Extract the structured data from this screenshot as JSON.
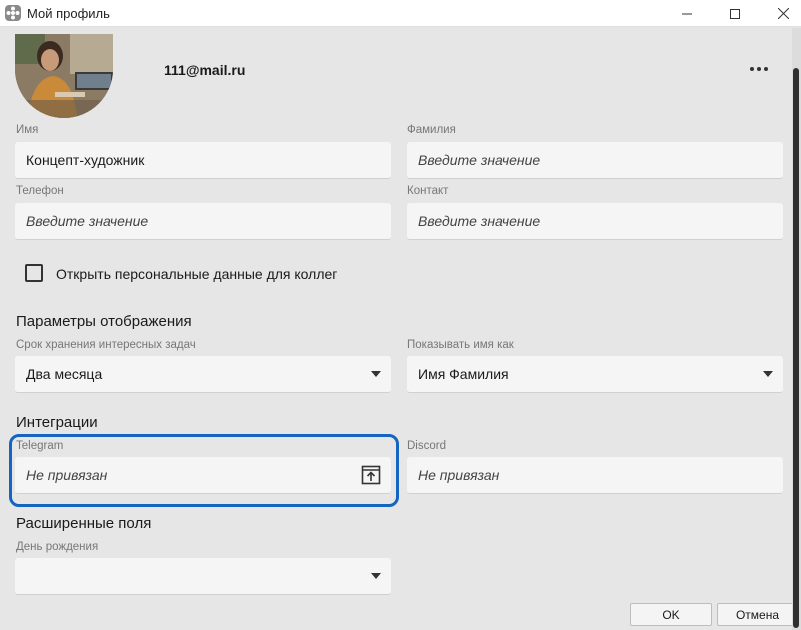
{
  "window": {
    "title": "Мой профиль"
  },
  "profile": {
    "email": "111@mail.ru"
  },
  "fields": {
    "first_name": {
      "label": "Имя",
      "value": "Концепт-художник"
    },
    "last_name": {
      "label": "Фамилия",
      "placeholder": "Введите значение"
    },
    "phone": {
      "label": "Телефон",
      "placeholder": "Введите значение"
    },
    "contact": {
      "label": "Контакт",
      "placeholder": "Введите значение"
    }
  },
  "checkbox": {
    "label": "Открыть персональные данные для коллег",
    "checked": false
  },
  "display_params": {
    "section_title": "Параметры отображения",
    "retention": {
      "label": "Срок хранения интересных задач",
      "value": "Два месяца"
    },
    "show_name_as": {
      "label": "Показывать имя как",
      "value": "Имя Фамилия"
    }
  },
  "integrations": {
    "section_title": "Интеграции",
    "telegram": {
      "label": "Telegram",
      "value": "Не привязан"
    },
    "discord": {
      "label": "Discord",
      "value": "Не привязан"
    }
  },
  "extended": {
    "section_title": "Расширенные поля",
    "birthday": {
      "label": "День рождения",
      "value": ""
    }
  },
  "buttons": {
    "ok": "OK",
    "cancel": "Отмена"
  },
  "colors": {
    "background": "#e6e6e6",
    "field": "#f5f5f5",
    "highlight": "#1565c0"
  },
  "icons": [
    "app-icon",
    "minimize-icon",
    "maximize-icon",
    "close-icon",
    "more-icon",
    "dropdown-arrow-icon",
    "open-link-icon"
  ]
}
